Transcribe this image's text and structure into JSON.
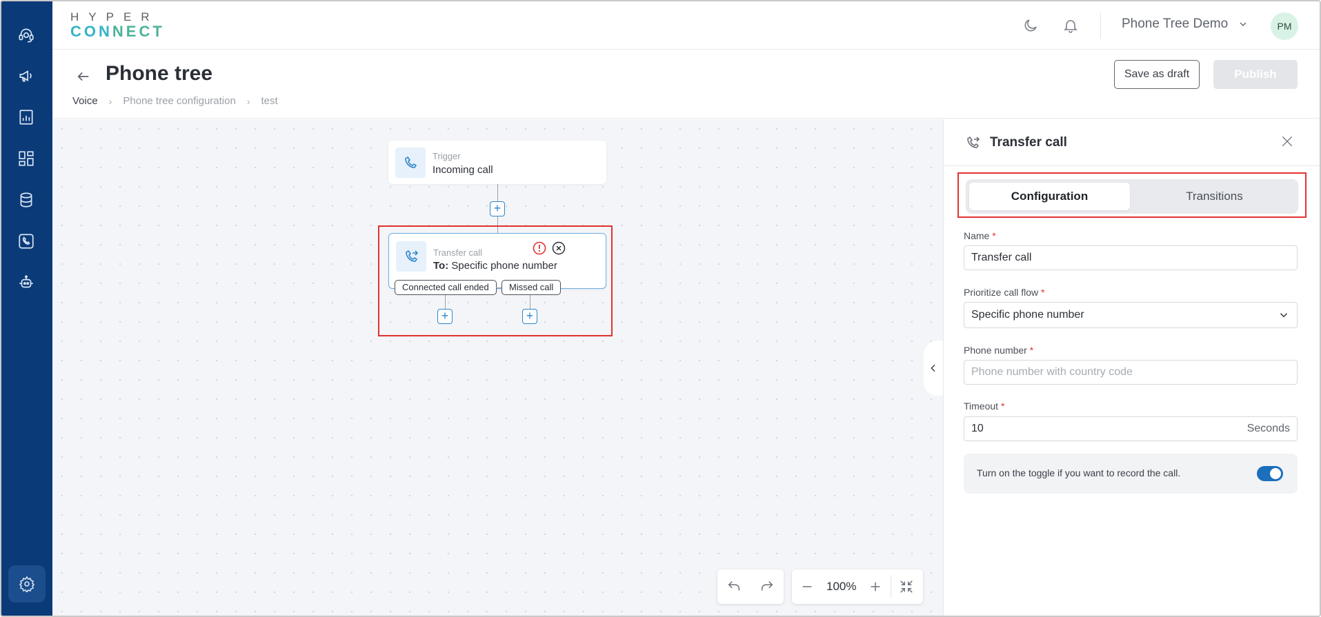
{
  "app": {
    "logo_top": "HYPER",
    "logo_bottom_a": "CON",
    "logo_bottom_b": "NECT",
    "workspace": "Phone Tree Demo",
    "avatar_initials": "PM"
  },
  "sidebar": {
    "items": [
      {
        "icon": "agent-headset-icon"
      },
      {
        "icon": "megaphone-icon"
      },
      {
        "icon": "reports-icon"
      },
      {
        "icon": "dashboard-grid-icon"
      },
      {
        "icon": "database-icon"
      },
      {
        "icon": "phone-icon"
      },
      {
        "icon": "bot-icon"
      }
    ],
    "settings_icon": "gear-icon"
  },
  "header": {
    "title": "Phone tree",
    "breadcrumb": [
      "Voice",
      "Phone tree configuration",
      "test"
    ],
    "save_draft_label": "Save as draft",
    "publish_label": "Publish"
  },
  "canvas": {
    "trigger": {
      "sub": "Trigger",
      "main": "Incoming call"
    },
    "transfer": {
      "sub": "Transfer call",
      "main_prefix": "To:",
      "main_value": "Specific phone number"
    },
    "transitions": [
      "Connected call ended",
      "Missed call"
    ],
    "zoom": "100%"
  },
  "panel": {
    "title": "Transfer call",
    "tabs": [
      "Configuration",
      "Transitions"
    ],
    "active_tab": "Configuration",
    "fields": {
      "name": {
        "label": "Name",
        "value": "Transfer call"
      },
      "flow": {
        "label": "Prioritize call flow",
        "value": "Specific phone number"
      },
      "phone": {
        "label": "Phone number",
        "placeholder": "Phone number with country code"
      },
      "timeout": {
        "label": "Timeout",
        "value": "10",
        "suffix": "Seconds"
      }
    },
    "record_text": "Turn on the toggle if you want to record the call.",
    "record_enabled": true
  },
  "colors": {
    "sidebar": "#0b3a78",
    "accent": "#2e86c9",
    "highlight": "#e0322f",
    "toggle_on": "#1b6fbd"
  }
}
